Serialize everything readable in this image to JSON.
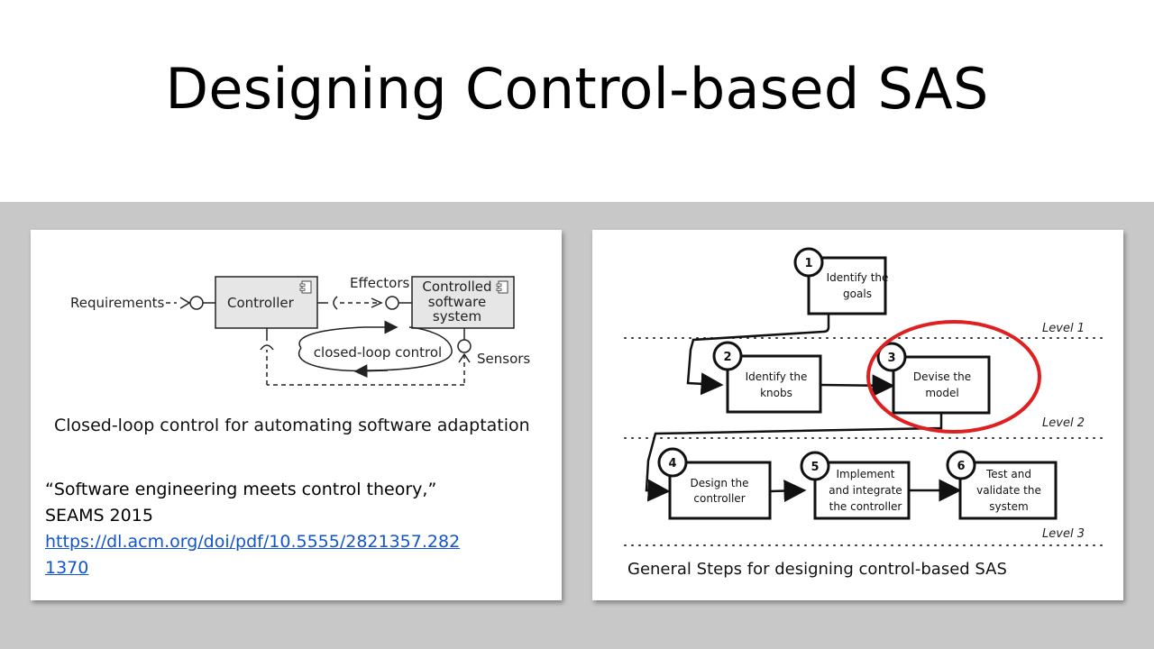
{
  "slide": {
    "title": "Designing Control-based SAS"
  },
  "left_panel": {
    "diagram": {
      "requirements": "Requirements",
      "controller": "Controller",
      "effectors": "Effectors",
      "system_line1": "Controlled",
      "system_line2": "software",
      "system_line3": "system",
      "loop_label": "closed-loop control",
      "sensors": "Sensors"
    },
    "caption": "Closed-loop control for automating software adaptation",
    "reference": {
      "line1": "“Software engineering meets control theory,”",
      "line2": "SEAMS 2015",
      "link_line1": "https://dl.acm.org/doi/pdf/10.5555/2821357.282",
      "link_line2": "1370"
    }
  },
  "right_panel": {
    "steps": [
      {
        "num": "1",
        "line1": "Identify the",
        "line2": "goals",
        "line3": ""
      },
      {
        "num": "2",
        "line1": "Identify the",
        "line2": "knobs",
        "line3": ""
      },
      {
        "num": "3",
        "line1": "Devise the",
        "line2": "model",
        "line3": ""
      },
      {
        "num": "4",
        "line1": "Design the",
        "line2": "controller",
        "line3": ""
      },
      {
        "num": "5",
        "line1": "Implement",
        "line2": "and integrate",
        "line3": "the controller"
      },
      {
        "num": "6",
        "line1": "Test and",
        "line2": "validate the",
        "line3": "system"
      }
    ],
    "levels": [
      "Level 1",
      "Level 2",
      "Level 3"
    ],
    "highlight_color": "#e02020",
    "caption": "General Steps for designing control-based SAS"
  }
}
